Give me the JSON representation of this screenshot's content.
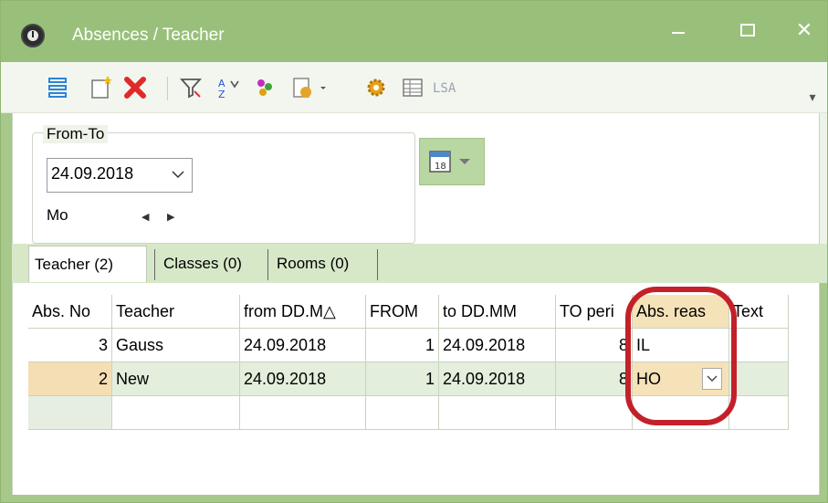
{
  "window": {
    "title": "Absences / Teacher",
    "min_label": "",
    "max_label": "",
    "close_label": "✕"
  },
  "toolbar": {
    "icons": [
      "list-icon",
      "new-document-icon",
      "delete-icon",
      "filter-icon",
      "sort-icon",
      "teachers-icon",
      "print-menu-icon",
      "settings-icon",
      "table-icon",
      "code-icon"
    ],
    "overflow_icon": "▾"
  },
  "date_range": {
    "legend": "From-To",
    "date": "24.09.2018",
    "day": "Mo"
  },
  "tabs": [
    {
      "label": "Teacher (2)"
    },
    {
      "label": "Classes (0)"
    },
    {
      "label": "Rooms (0)"
    }
  ],
  "grid": {
    "columns": [
      "Abs. No",
      "Teacher",
      "from DD.M△",
      "FROM",
      "to DD.MM",
      "TO peri",
      "Abs. reas",
      "Text"
    ],
    "rows": [
      {
        "abs_no": "3",
        "teacher": "Gauss",
        "from_date": "24.09.2018",
        "from_period": "1",
        "to_date": "24.09.2018",
        "to_period": "8",
        "reason": "IL",
        "text": ""
      },
      {
        "abs_no": "2",
        "teacher": "New",
        "from_date": "24.09.2018",
        "from_period": "1",
        "to_date": "24.09.2018",
        "to_period": "8",
        "reason": "HO",
        "text": ""
      }
    ]
  },
  "colors": {
    "title_bar": "#98c07a",
    "selected_row": "#e3eedc",
    "row_number_highlight": "#f5deb3",
    "annotation_ring": "#c3202a"
  }
}
